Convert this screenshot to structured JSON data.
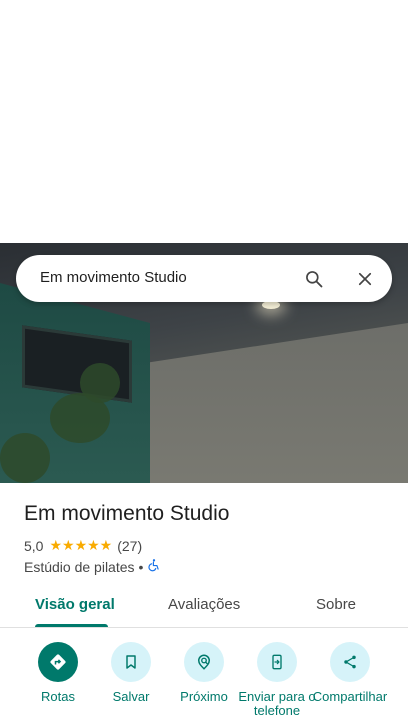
{
  "search": {
    "query": "Em movimento Studio"
  },
  "place": {
    "name": "Em movimento Studio",
    "rating": "5,0",
    "stars": "★★★★★",
    "review_count": "(27)",
    "category": "Estúdio de pilates",
    "separator": "•"
  },
  "tabs": [
    {
      "label": "Visão geral",
      "active": true
    },
    {
      "label": "Avaliações",
      "active": false
    },
    {
      "label": "Sobre",
      "active": false
    }
  ],
  "actions": [
    {
      "label": "Rotas",
      "icon": "directions-icon"
    },
    {
      "label": "Salvar",
      "icon": "bookmark-icon"
    },
    {
      "label": "Próximo",
      "icon": "nearby-icon"
    },
    {
      "label": "Enviar para o telefone",
      "icon": "send-to-phone-icon"
    },
    {
      "label": "Compartilhar",
      "icon": "share-icon"
    }
  ],
  "colors": {
    "accent": "#00796b",
    "chip": "#d6f3f9",
    "star": "#f9ab00",
    "accessibility": "#1a73e8"
  }
}
